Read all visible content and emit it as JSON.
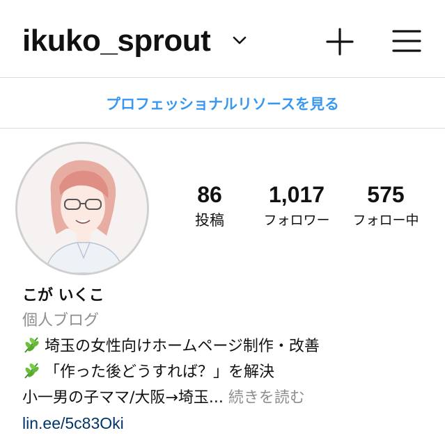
{
  "header": {
    "username": "ikuko_sprout",
    "dropdown_icon": "chevron-down-icon",
    "new_post_icon": "plus-icon",
    "menu_icon": "hamburger-menu-icon"
  },
  "professional_resources": {
    "label": "プロフェッショナルリソースを見る",
    "color": "#3897f0"
  },
  "profile": {
    "stats": [
      {
        "value": "86",
        "label": "投稿"
      },
      {
        "value": "1,017",
        "label": "フォロワー"
      },
      {
        "value": "575",
        "label": "フォロー中"
      }
    ],
    "display_name": "こが いくこ",
    "category": "個人ブログ",
    "bio_lines": [
      {
        "icon": "herb-emoji",
        "text": "埼玉の女性向けホームページ制作・改善"
      },
      {
        "icon": "herb-emoji",
        "text": "「作った後どうすれば？」を解決"
      }
    ],
    "bio_truncated": "小一男の子ママ/大阪→埼玉...",
    "more_label": " 続きを読む",
    "link": "lin.ee/5c83Oki",
    "link_color": "#003569"
  }
}
